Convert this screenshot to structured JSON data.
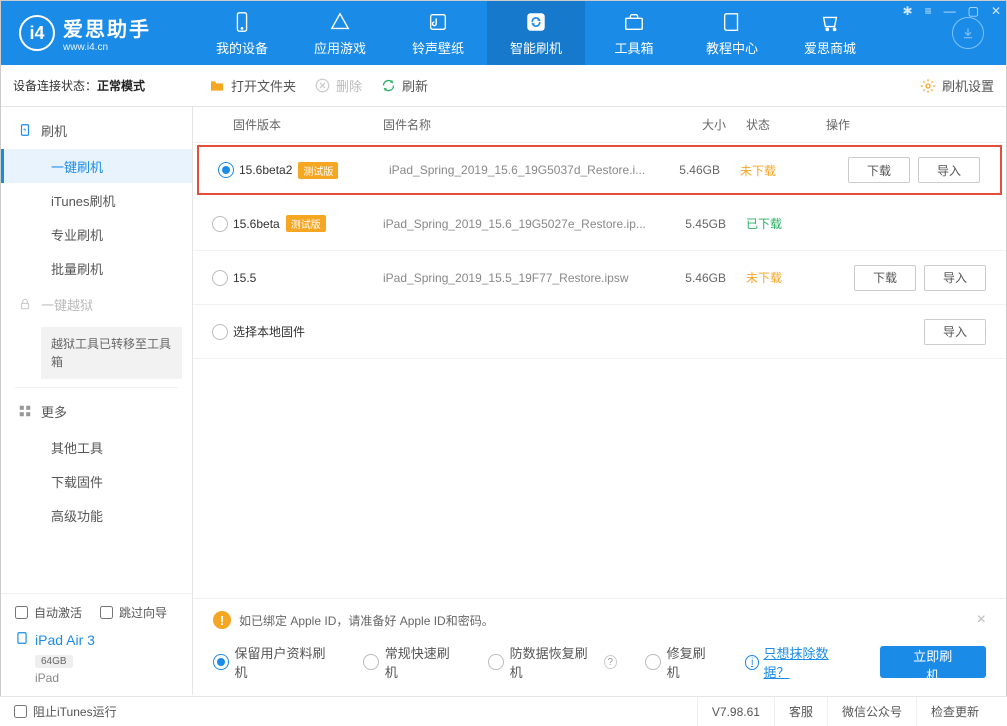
{
  "brand": {
    "title": "爱思助手",
    "url": "www.i4.cn"
  },
  "nav": {
    "items": [
      {
        "label": "我的设备"
      },
      {
        "label": "应用游戏"
      },
      {
        "label": "铃声壁纸"
      },
      {
        "label": "智能刷机"
      },
      {
        "label": "工具箱"
      },
      {
        "label": "教程中心"
      },
      {
        "label": "爱思商城"
      }
    ]
  },
  "status_bar": {
    "label": "设备连接状态：",
    "value": "正常模式"
  },
  "toolbar": {
    "open_folder": "打开文件夹",
    "delete": "删除",
    "refresh": "刷新",
    "settings": "刷机设置"
  },
  "sidebar": {
    "flash": {
      "label": "刷机",
      "items": [
        "一键刷机",
        "iTunes刷机",
        "专业刷机",
        "批量刷机"
      ]
    },
    "jailbreak": {
      "label": "一键越狱",
      "note": "越狱工具已转移至工具箱"
    },
    "more": {
      "label": "更多",
      "items": [
        "其他工具",
        "下载固件",
        "高级功能"
      ]
    },
    "auto_activate": "自动激活",
    "skip_guide": "跳过向导"
  },
  "device": {
    "name": "iPad Air 3",
    "storage": "64GB",
    "type": "iPad"
  },
  "table": {
    "headers": {
      "version": "固件版本",
      "name": "固件名称",
      "size": "大小",
      "status": "状态",
      "ops": "操作"
    },
    "download": "下载",
    "import": "导入",
    "local_label": "选择本地固件",
    "beta_badge": "测试版",
    "rows": [
      {
        "selected": true,
        "version": "15.6beta2",
        "beta": true,
        "name": "iPad_Spring_2019_15.6_19G5037d_Restore.i...",
        "size": "5.46GB",
        "status": "未下载",
        "status_class": "nd",
        "show_dl": true
      },
      {
        "selected": false,
        "version": "15.6beta",
        "beta": true,
        "name": "iPad_Spring_2019_15.6_19G5027e_Restore.ip...",
        "size": "5.45GB",
        "status": "已下载",
        "status_class": "dl",
        "show_dl": false
      },
      {
        "selected": false,
        "version": "15.5",
        "beta": false,
        "name": "iPad_Spring_2019_15.5_19F77_Restore.ipsw",
        "size": "5.46GB",
        "status": "未下载",
        "status_class": "nd",
        "show_dl": true
      }
    ]
  },
  "tip": "如已绑定 Apple ID，请准备好 Apple ID和密码。",
  "options": {
    "retain": "保留用户资料刷机",
    "regular": "常规快速刷机",
    "antierase": "防数据恢复刷机",
    "repair": "修复刷机",
    "erase_link": "只想抹除数据？",
    "flash_now": "立即刷机"
  },
  "footer": {
    "block_itunes": "阻止iTunes运行",
    "version": "V7.98.61",
    "service": "客服",
    "wechat": "微信公众号",
    "update": "检查更新"
  }
}
